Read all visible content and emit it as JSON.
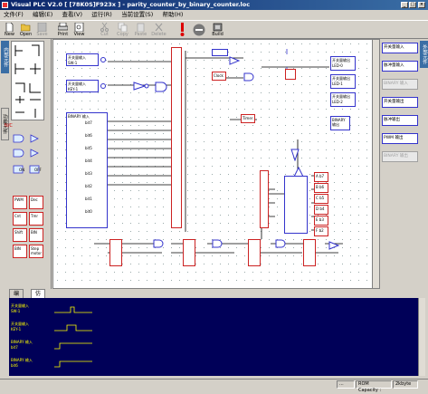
{
  "window": {
    "title": "Visual PLC V2.0 [ [78K0S]F923x ] - parity_counter_by_binary_counter.loc",
    "minimize": "_",
    "maximize": "□",
    "close": "×"
  },
  "menu": [
    "文件(F)",
    "编辑(E)",
    "查看(V)",
    "运行(R)",
    "当前设置(S)",
    "帮助(H)"
  ],
  "toolbar": [
    {
      "label": "New",
      "icon": "new-file-icon",
      "enabled": true
    },
    {
      "label": "Open",
      "icon": "open-folder-icon",
      "enabled": true
    },
    {
      "label": "Save",
      "icon": "save-icon",
      "enabled": false
    },
    {
      "label": "Print",
      "icon": "print-icon",
      "enabled": true
    },
    {
      "label": "View",
      "icon": "view-icon",
      "enabled": true
    },
    {
      "label": "Cut",
      "icon": "cut-icon",
      "enabled": false
    },
    {
      "label": "Copy",
      "icon": "copy-icon",
      "enabled": false
    },
    {
      "label": "Paste",
      "icon": "paste-icon",
      "enabled": false
    },
    {
      "label": "Delete",
      "icon": "delete-icon",
      "enabled": false
    },
    {
      "label": "",
      "icon": "run-icon",
      "enabled": true
    },
    {
      "label": "",
      "icon": "stop-icon",
      "enabled": true
    },
    {
      "label": "Build",
      "icon": "build-icon",
      "enabled": true
    }
  ],
  "left_tabs": [
    "内部元件",
    "功能元件"
  ],
  "left_labels": {
    "nc": "N/C",
    "on": "ON",
    "off": "OFF",
    "pulse": "PWM",
    "decoder": "Dec",
    "counter": "Cnt",
    "timer": "Tmr",
    "shift": "Shift",
    "binary": "BIN",
    "motor": "Step motor"
  },
  "right_tab": "外部元件",
  "right_buttons": [
    {
      "label": "开关量输入",
      "enabled": true
    },
    {
      "label": "脉冲量输入",
      "enabled": true
    },
    {
      "label": "BINARY 输入",
      "enabled": false
    },
    {
      "label": "开关量输出",
      "enabled": true
    },
    {
      "label": "脉冲输出",
      "enabled": true
    },
    {
      "label": "PWM 输出",
      "enabled": true
    },
    {
      "label": "BINARY 输出",
      "enabled": false
    }
  ],
  "canvas": {
    "in_sw0": "开关量输入\nSW-1",
    "in_key1": "开关量输入\nKEY-1",
    "in_binary": "BINARY 输入",
    "bits": [
      "bit7",
      "bit6",
      "bit5",
      "bit4",
      "bit3",
      "bit2",
      "bit1",
      "bit0"
    ],
    "out_led0": "开关量输出\nLED-0",
    "out_led1": "开关量输出\nLED-1",
    "out_led2": "开关量输出\nLED-2",
    "out_binary": "BINARY\n输出",
    "clock": "Clock",
    "timer": "Timer",
    "mux_bits": [
      "A b7",
      "B b6",
      "C b5",
      "D b4",
      "E b3",
      "F b2",
      "G b1",
      "H b0"
    ]
  },
  "bottom_tabs": [
    "编译",
    "仿真"
  ],
  "scope": [
    {
      "label": "开关量输入\nSW-1"
    },
    {
      "label": "开关量输入\nKEY-1"
    },
    {
      "label": "BINARY 输入\nbit7"
    },
    {
      "label": "BINARY 输入\nbit6"
    }
  ],
  "status": {
    "dots": "...",
    "rom_label": "ROM Capacity :",
    "rom_value": "2kbyte"
  }
}
